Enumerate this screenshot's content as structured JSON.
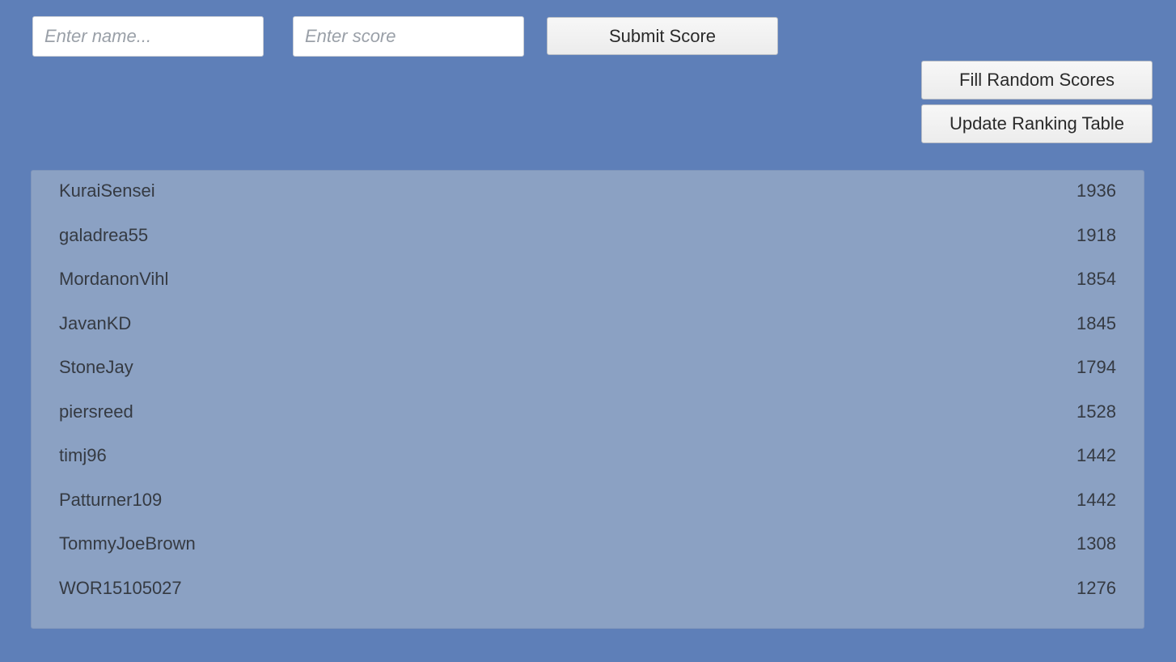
{
  "inputs": {
    "name_placeholder": "Enter name...",
    "name_value": "",
    "score_placeholder": "Enter score",
    "score_value": ""
  },
  "buttons": {
    "submit": "Submit Score",
    "fill_random": "Fill Random Scores",
    "update_ranking": "Update Ranking Table"
  },
  "ranking": [
    {
      "name": "KuraiSensei",
      "score": "1936"
    },
    {
      "name": "galadrea55",
      "score": "1918"
    },
    {
      "name": "MordanonVihl",
      "score": "1854"
    },
    {
      "name": "JavanKD",
      "score": "1845"
    },
    {
      "name": "StoneJay",
      "score": "1794"
    },
    {
      "name": "piersreed",
      "score": "1528"
    },
    {
      "name": "timj96",
      "score": "1442"
    },
    {
      "name": "Patturner109",
      "score": "1442"
    },
    {
      "name": "TommyJoeBrown",
      "score": "1308"
    },
    {
      "name": "WOR15105027",
      "score": "1276"
    }
  ],
  "colors": {
    "background": "#5e7fb8",
    "panel": "#8ba1c3",
    "text": "#353a42"
  }
}
